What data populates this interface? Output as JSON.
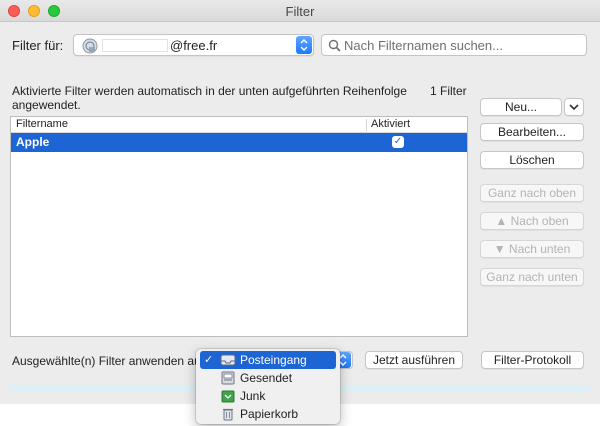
{
  "window": {
    "title": "Filter"
  },
  "header": {
    "filter_for_label": "Filter für:",
    "account_domain": "@free.fr",
    "search_placeholder": "Nach Filternamen suchen..."
  },
  "description": "Aktivierte Filter werden automatisch in der unten aufgeführten Reihenfolge angewendet.",
  "filter_count": "1 Filter",
  "table": {
    "columns": [
      "Filtername",
      "Aktiviert"
    ],
    "rows": [
      {
        "name": "Apple",
        "activated": true
      }
    ]
  },
  "buttons": {
    "new": "Neu...",
    "edit": "Bearbeiten...",
    "delete": "Löschen",
    "to_top": "Ganz nach oben",
    "up": "Nach oben",
    "down": "Nach unten",
    "to_bottom": "Ganz nach unten",
    "run_now": "Jetzt ausführen",
    "log": "Filter-Protokoll"
  },
  "apply_label": "Ausgewählte(n) Filter anwenden auf:",
  "folder_menu": {
    "selected": "Posteingang",
    "items": [
      {
        "label": "Posteingang",
        "icon": "inbox-icon",
        "checked": true
      },
      {
        "label": "Gesendet",
        "icon": "sent-icon",
        "checked": false
      },
      {
        "label": "Junk",
        "icon": "junk-icon",
        "checked": false
      },
      {
        "label": "Papierkorb",
        "icon": "trash-icon",
        "checked": false
      }
    ]
  },
  "colors": {
    "selection": "#1d65d4",
    "accent": "#1f78ff"
  }
}
